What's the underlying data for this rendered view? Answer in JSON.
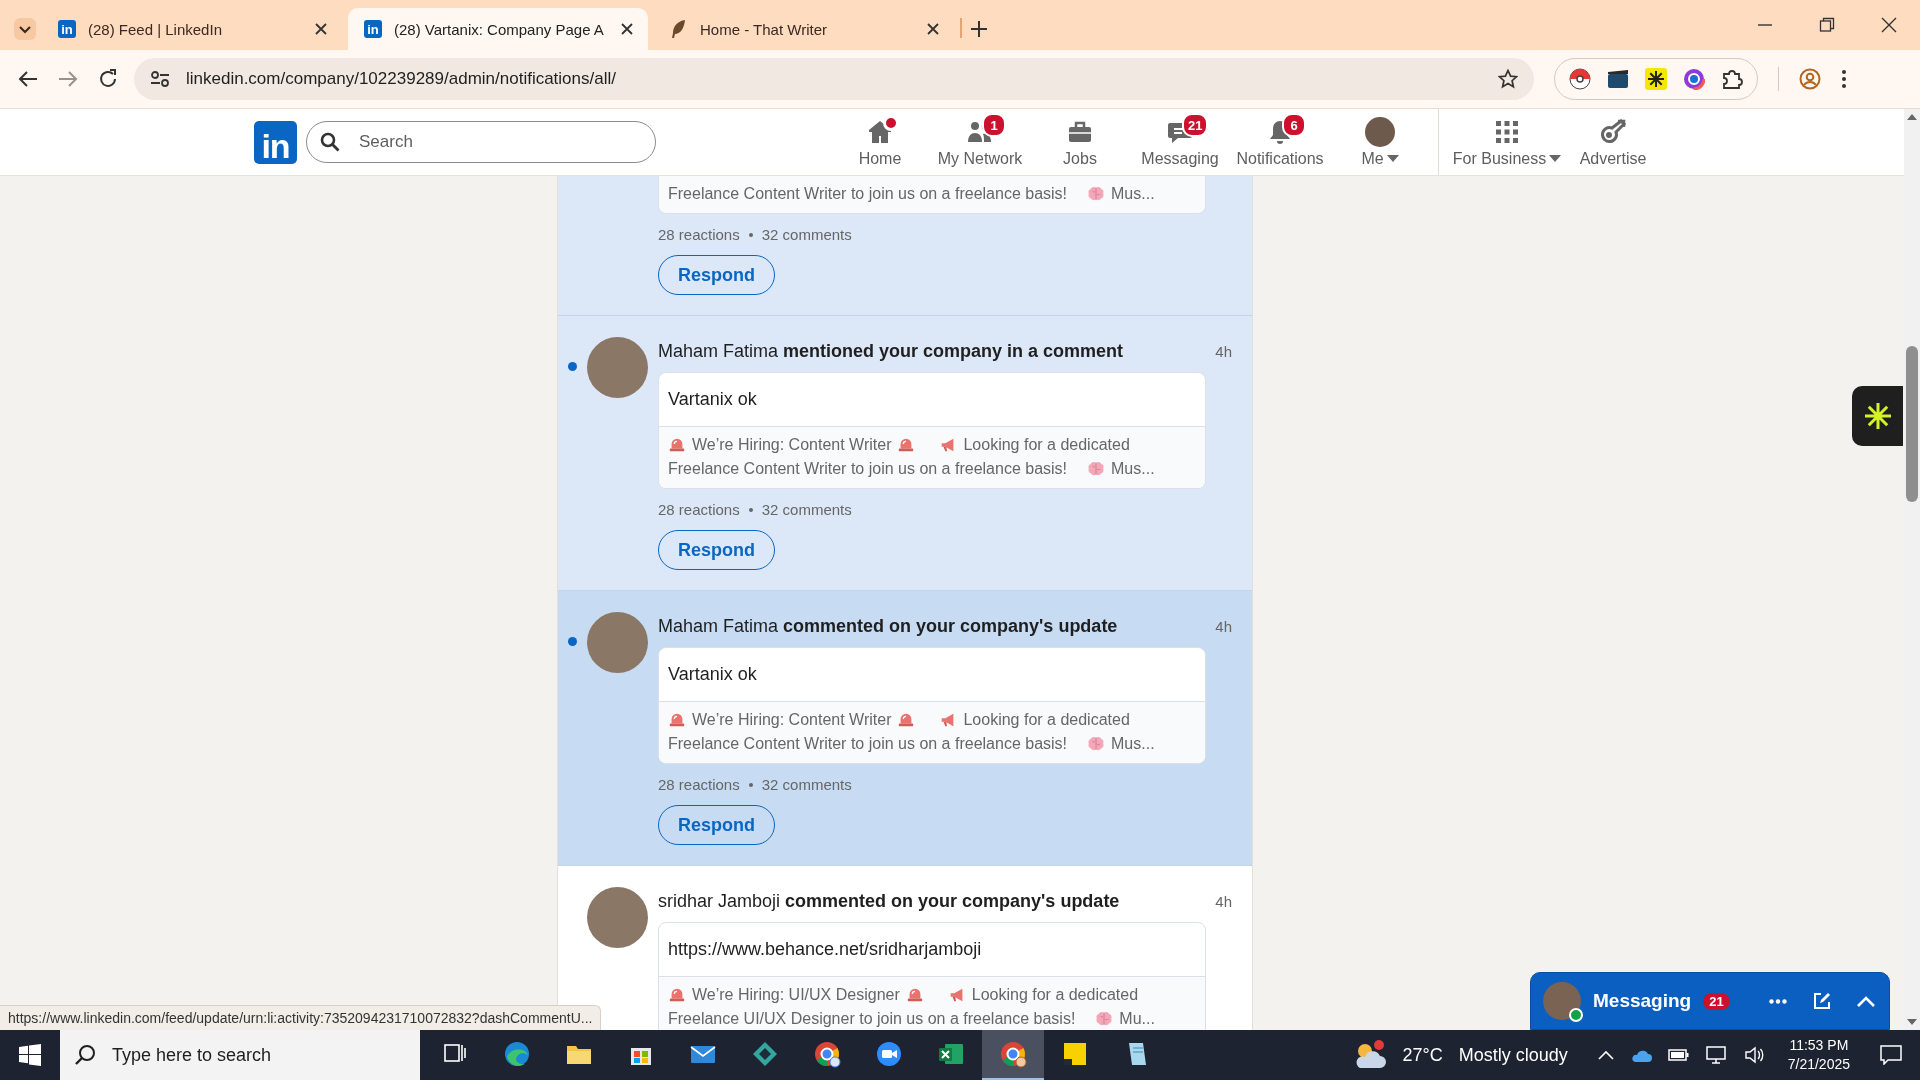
{
  "browser": {
    "tabs": [
      {
        "kind": "linkedin",
        "favicon": "in",
        "title": "(28) Feed | LinkedIn",
        "selected": false
      },
      {
        "kind": "linkedin",
        "favicon": "in",
        "title": "(28) Vartanix: Company Page A",
        "selected": true
      },
      {
        "kind": "feather",
        "title": "Home - That Writer",
        "selected": false
      }
    ],
    "forward_enabled": false,
    "address": "linkedin.com/company/102239289/admin/notifications/all/"
  },
  "nav": {
    "logo": "in",
    "search": {
      "placeholder": "Search"
    },
    "items": [
      {
        "label": "Home",
        "dot": true,
        "dropdown": false
      },
      {
        "label": "My Network",
        "badge": "1",
        "dot": false,
        "dropdown": false
      },
      {
        "label": "Jobs",
        "dot": false,
        "dropdown": false
      },
      {
        "label": "Messaging",
        "badge": "21",
        "dot": false,
        "dropdown": false
      },
      {
        "label": "Notifications",
        "badge": "6",
        "dot": false,
        "dropdown": false
      },
      {
        "label": "Me",
        "dot": false,
        "dropdown": true
      }
    ],
    "business_items": [
      {
        "label": "For Business",
        "dot": false,
        "dropdown": true
      },
      {
        "label": "Advertise",
        "dot": false,
        "dropdown": false
      }
    ]
  },
  "notifications": [
    {
      "kind": "partial",
      "unread": true,
      "hovered": false,
      "preview": [
        [
          {
            "kind": "text",
            "text": "Freelance Content Writer to join us on a freelance basis!"
          },
          {
            "kind": "brain"
          },
          {
            "kind": "text",
            "text": "Mus..."
          }
        ]
      ],
      "reactions": "28 reactions",
      "comments": "32 comments",
      "button": "Respond"
    },
    {
      "kind": "full",
      "unread": true,
      "hovered": false,
      "headline": "Maham Fatima **mentioned your company in a comment**",
      "time": "4h",
      "comment": "Vartanix ok",
      "preview": [
        [
          {
            "kind": "siren"
          },
          {
            "kind": "text",
            "text": "We’re Hiring: Content Writer"
          },
          {
            "kind": "siren"
          },
          {
            "kind": "megaphone"
          },
          {
            "kind": "text",
            "text": "Looking for a dedicated"
          }
        ],
        [
          {
            "kind": "text",
            "text": "Freelance Content Writer to join us on a freelance basis!"
          },
          {
            "kind": "brain"
          },
          {
            "kind": "text",
            "text": "Mus..."
          }
        ]
      ],
      "reactions": "28 reactions",
      "comments": "32 comments",
      "button": "Respond"
    },
    {
      "kind": "full",
      "unread": true,
      "hovered": true,
      "headline": "Maham Fatima **commented on your company's update**",
      "time": "4h",
      "comment": "Vartanix ok",
      "preview": [
        [
          {
            "kind": "siren"
          },
          {
            "kind": "text",
            "text": "We’re Hiring: Content Writer"
          },
          {
            "kind": "siren"
          },
          {
            "kind": "megaphone"
          },
          {
            "kind": "text",
            "text": "Looking for a dedicated"
          }
        ],
        [
          {
            "kind": "text",
            "text": "Freelance Content Writer to join us on a freelance basis!"
          },
          {
            "kind": "brain"
          },
          {
            "kind": "text",
            "text": "Mus..."
          }
        ]
      ],
      "reactions": "28 reactions",
      "comments": "32 comments",
      "button": "Respond"
    },
    {
      "kind": "full",
      "unread": false,
      "hovered": false,
      "headline": "sridhar Jamboji **commented on your company's update**",
      "time": "4h",
      "comment": "https://www.behance.net/sridharjamboji",
      "preview": [
        [
          {
            "kind": "siren"
          },
          {
            "kind": "text",
            "text": "We’re Hiring: UI/UX Designer"
          },
          {
            "kind": "siren"
          },
          {
            "kind": "megaphone"
          },
          {
            "kind": "text",
            "text": "Looking for a dedicated"
          }
        ],
        [
          {
            "kind": "text",
            "text": "Freelance UI/UX Designer to join us on a freelance basis!"
          },
          {
            "kind": "brain"
          },
          {
            "kind": "text",
            "text": "Mu..."
          }
        ]
      ]
    }
  ],
  "status_url": "https://www.linkedin.com/feed/update/urn:li:activity:7352094231710072832?dashCommentU...",
  "messaging": {
    "title": "Messaging",
    "badge": "21"
  },
  "taskbar": {
    "search_placeholder": "Type here to search",
    "apps": [
      {
        "selected": false
      },
      {
        "selected": false
      },
      {
        "selected": false
      },
      {
        "selected": false
      },
      {
        "selected": false
      },
      {
        "selected": false
      },
      {
        "selected": false
      },
      {
        "selected": false
      },
      {
        "selected": false
      },
      {
        "selected": true
      },
      {
        "selected": false
      },
      {
        "selected": false
      }
    ],
    "weather": {
      "temperature": "27°C",
      "condition": "Mostly cloudy"
    },
    "time": "11:53 PM",
    "date": "7/21/2025"
  }
}
